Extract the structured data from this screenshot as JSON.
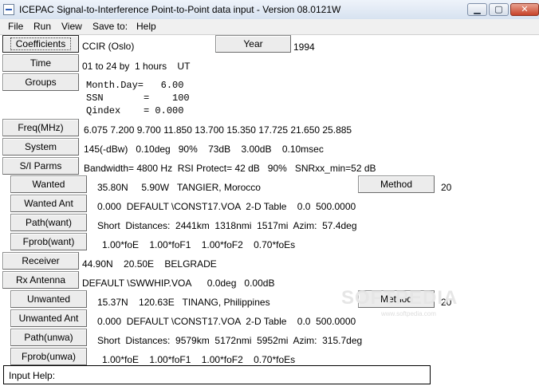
{
  "window": {
    "title": "ICEPAC Signal-to-Interference Point-to-Point data input - Version 08.0121W",
    "minimize": "▁",
    "maximize": "▢",
    "close": "✕"
  },
  "menu": [
    "File",
    "Run",
    "View",
    "Save to:",
    "Help"
  ],
  "buttons": {
    "coefficients": "Coefficients",
    "year": "Year",
    "time": "Time",
    "groups": "Groups",
    "freq": "Freq(MHz)",
    "system": "System",
    "si_parms": "S/I Parms",
    "wanted": "Wanted",
    "wanted_ant": "Wanted Ant",
    "path_want": "Path(want)",
    "fprob_want": "Fprob(want)",
    "receiver": "Receiver",
    "rx_antenna": "Rx Antenna",
    "unwanted": "Unwanted",
    "unwanted_ant": "Unwanted Ant",
    "path_unwa": "Path(unwa)",
    "fprob_unwa": "Fprob(unwa)",
    "method_wanted": "Method",
    "method_unwanted": "Method"
  },
  "values": {
    "coefficients": "CCIR (Oslo)",
    "year": "1994",
    "time": "01 to 24 by  1 hours    UT",
    "groups_line1": "Month.Day=   6.00",
    "groups_line2": "SSN       =    100",
    "groups_line3": "Qindex    = 0.000",
    "freq": "6.075  7.200  9.700 11.850 13.700 15.350 17.725 21.650 25.885",
    "system": "145(-dBw)   0.10deg   90%    73dB    3.00dB    0.10msec",
    "si_parms": "Bandwidth= 4800 Hz  RSI Protect= 42 dB   90%   SNRxx_min=52 dB",
    "wanted": "35.80N     5.90W   TANGIER, Morocco",
    "method_wanted": "20",
    "wanted_ant": "0.000  DEFAULT \\CONST17.VOA  2-D Table    0.0  500.0000",
    "path_want": "Short  Distances:  2441km  1318nmi  1517mi  Azim:  57.4deg",
    "fprob_want": "1.00*foE    1.00*foF1    1.00*foF2    0.70*foEs",
    "receiver": "44.90N    20.50E    BELGRADE",
    "rx_antenna": "DEFAULT \\SWWHIP.VOA      0.0deg   0.00dB",
    "unwanted": "15.37N    120.63E   TINANG, Philippines",
    "method_unwanted": "20",
    "unwanted_ant": "0.000  DEFAULT \\CONST17.VOA  2-D Table    0.0  500.0000",
    "path_unwa": "Short  Distances:  9579km  5172nmi  5952mi  Azim:  315.7deg",
    "fprob_unwa": "1.00*foE    1.00*foF1    1.00*foF2    0.70*foEs"
  },
  "input_help": "Input Help:",
  "watermark": "SOFTPEDIA",
  "watermark_url": "www.softpedia.com"
}
